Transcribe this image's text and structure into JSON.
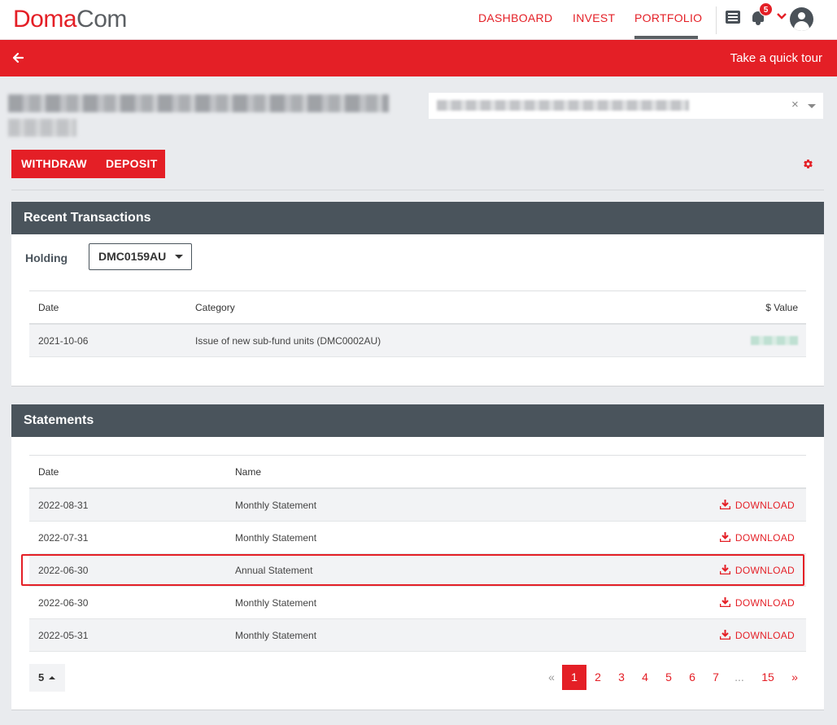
{
  "app": {
    "logo_part1": "Doma",
    "logo_part2": "Com"
  },
  "nav": {
    "dashboard": "DASHBOARD",
    "invest": "INVEST",
    "portfolio": "PORTFOLIO",
    "notification_count": "5"
  },
  "redbar": {
    "tour": "Take a quick tour"
  },
  "selector": {
    "clear": "×"
  },
  "actions": {
    "withdraw": "WITHDRAW",
    "deposit": "DEPOSIT"
  },
  "recent_transactions": {
    "title": "Recent Transactions",
    "holding_label": "Holding",
    "holding_value": "DMC0159AU",
    "columns": {
      "date": "Date",
      "category": "Category",
      "value": "$ Value"
    },
    "rows": [
      {
        "date": "2021-10-06",
        "category": "Issue of new sub-fund units (DMC0002AU)"
      }
    ]
  },
  "statements": {
    "title": "Statements",
    "columns": {
      "date": "Date",
      "name": "Name"
    },
    "download_label": "DOWNLOAD",
    "rows": [
      {
        "date": "2022-08-31",
        "name": "Monthly Statement"
      },
      {
        "date": "2022-07-31",
        "name": "Monthly Statement"
      },
      {
        "date": "2022-06-30",
        "name": "Annual Statement"
      },
      {
        "date": "2022-06-30",
        "name": "Monthly Statement"
      },
      {
        "date": "2022-05-31",
        "name": "Monthly Statement"
      }
    ],
    "page_size": "5",
    "pagination": {
      "prev": "«",
      "pages": [
        "1",
        "2",
        "3",
        "4",
        "5",
        "6",
        "7"
      ],
      "ellipsis": "...",
      "last": "15",
      "next": "»",
      "current": "1"
    }
  },
  "colors": {
    "brand_red": "#e41f26",
    "header_gray": "#4a545c",
    "page_bg": "#e9ebee"
  }
}
